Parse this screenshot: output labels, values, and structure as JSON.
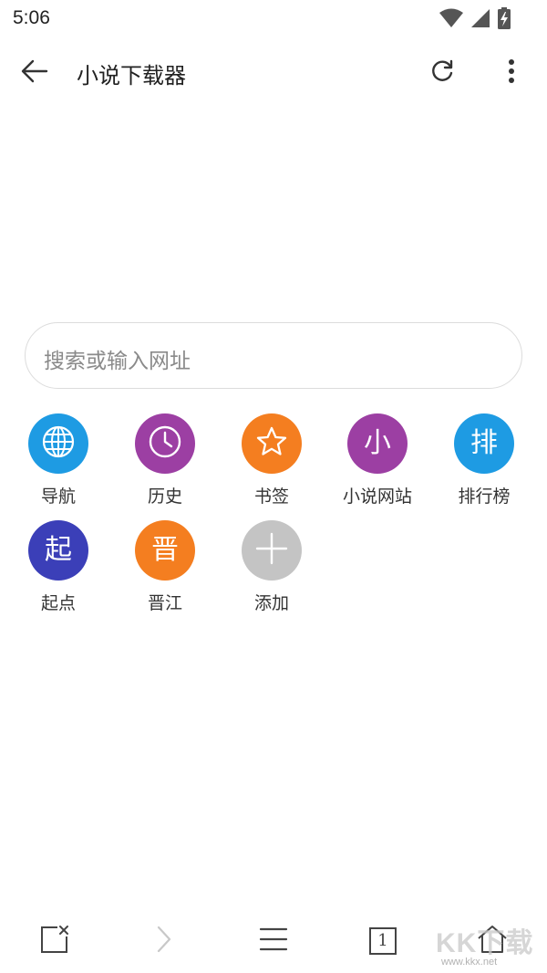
{
  "status_bar": {
    "time": "5:06",
    "icons": [
      "wifi-icon",
      "cell-signal-icon",
      "battery-charging-icon"
    ]
  },
  "app_bar": {
    "title": "小说下载器",
    "back_icon": "arrow-left-icon",
    "refresh_icon": "refresh-icon",
    "more_icon": "more-vertical-icon"
  },
  "search": {
    "placeholder": "搜索或输入网址"
  },
  "shortcuts": [
    {
      "label": "导航",
      "icon": "globe-icon",
      "color": "#1E9BE3"
    },
    {
      "label": "历史",
      "icon": "clock-icon",
      "color": "#9C3FA3"
    },
    {
      "label": "书签",
      "icon": "star-icon",
      "color": "#F47E20"
    },
    {
      "label": "小说网站",
      "glyph": "小",
      "color": "#9C3FA3"
    },
    {
      "label": "排行榜",
      "glyph": "排",
      "color": "#1E9BE3"
    },
    {
      "label": "起点",
      "glyph": "起",
      "color": "#3B3FB8"
    },
    {
      "label": "晋江",
      "glyph": "晋",
      "color": "#F47E20"
    },
    {
      "label": "添加",
      "icon": "plus-icon",
      "color": "#C4C4C4"
    }
  ],
  "bottom_bar": {
    "items": [
      "close-tab-icon",
      "forward-icon",
      "menu-icon",
      "tabs-count-icon",
      "home-icon"
    ],
    "tab_count": "1"
  },
  "watermark": {
    "text": "KK下载",
    "url": "www.kkx.net"
  }
}
